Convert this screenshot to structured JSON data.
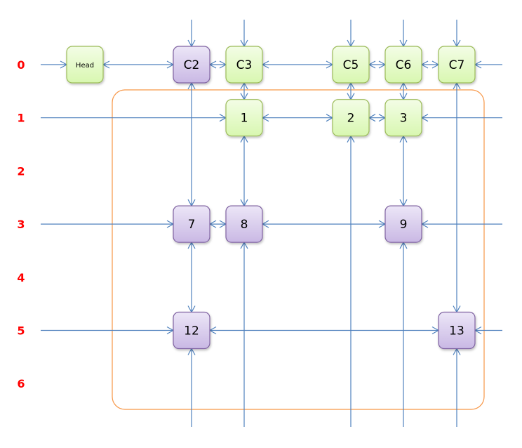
{
  "row_labels": [
    "0",
    "1",
    "2",
    "3",
    "4",
    "5",
    "6"
  ],
  "colors": {
    "green_fill_top": "#f3fde6",
    "green_fill_bottom": "#d8f7b0",
    "green_stroke": "#9bbb59",
    "purple_fill_top": "#ece6f7",
    "purple_fill_bottom": "#c9b8e4",
    "purple_stroke": "#8064a2",
    "link": "#4f81bd",
    "group_outline": "#f79646",
    "row_label": "#ff0000"
  },
  "nodes": [
    {
      "id": "Head",
      "label": "Head",
      "row": 0,
      "col": "H",
      "style": "green"
    },
    {
      "id": "C2",
      "label": "C2",
      "row": 0,
      "col": "C2",
      "style": "purple"
    },
    {
      "id": "C3",
      "label": "C3",
      "row": 0,
      "col": "C3",
      "style": "green"
    },
    {
      "id": "C5",
      "label": "C5",
      "row": 0,
      "col": "C5",
      "style": "green"
    },
    {
      "id": "C6",
      "label": "C6",
      "row": 0,
      "col": "C6",
      "style": "green"
    },
    {
      "id": "C7",
      "label": "C7",
      "row": 0,
      "col": "C7",
      "style": "green"
    },
    {
      "id": "n1",
      "label": "1",
      "row": 1,
      "col": "C3",
      "style": "green"
    },
    {
      "id": "n2",
      "label": "2",
      "row": 1,
      "col": "C5",
      "style": "green"
    },
    {
      "id": "n3",
      "label": "3",
      "row": 1,
      "col": "C6",
      "style": "green"
    },
    {
      "id": "n7",
      "label": "7",
      "row": 3,
      "col": "C2",
      "style": "purple"
    },
    {
      "id": "n8",
      "label": "8",
      "row": 3,
      "col": "C3",
      "style": "purple"
    },
    {
      "id": "n9",
      "label": "9",
      "row": 3,
      "col": "C6",
      "style": "purple"
    },
    {
      "id": "n12",
      "label": "12",
      "row": 5,
      "col": "C2",
      "style": "purple"
    },
    {
      "id": "n13",
      "label": "13",
      "row": 5,
      "col": "C7",
      "style": "purple"
    }
  ],
  "rows": [
    [
      "Head",
      "C2",
      "C3",
      "C5",
      "C6",
      "C7"
    ],
    [
      "n1",
      "n2",
      "n3"
    ],
    [
      "n7",
      "n8",
      "n9"
    ],
    [
      "n12",
      "n13"
    ]
  ],
  "columns": [
    [
      "C2",
      "n7",
      "n12"
    ],
    [
      "C3",
      "n1",
      "n8"
    ],
    [
      "C5",
      "n2"
    ],
    [
      "C6",
      "n3",
      "n9"
    ],
    [
      "C7",
      "n13"
    ]
  ]
}
